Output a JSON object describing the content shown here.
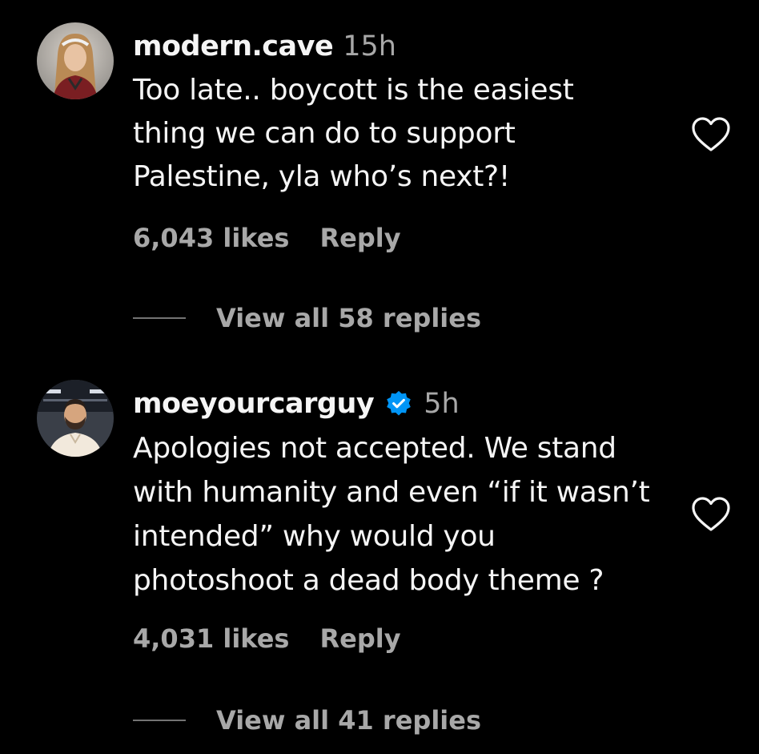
{
  "comments": [
    {
      "username": "modern.cave",
      "time": "15h",
      "verified": false,
      "text_lines": [
        "Too late.. boycott is the easiest",
        "thing we can do to support",
        "Palestine, yla who’s next?!"
      ],
      "likes": "6,043 likes",
      "reply_label": "Reply",
      "view_replies": "View all 58 replies"
    },
    {
      "username": "moeyourcarguy",
      "time": "5h",
      "verified": true,
      "text_lines": [
        "Apologies not accepted. We stand",
        "with humanity and even “if it wasn’t",
        "intended” why would you",
        "photoshoot a dead body theme ?"
      ],
      "likes": "4,031 likes",
      "reply_label": "Reply",
      "view_replies": "View all 41 replies"
    }
  ],
  "colors": {
    "background": "#000000",
    "primary_text": "#f5f5f5",
    "secondary_text": "#a8a8a8",
    "verified_badge": "#0095f6"
  },
  "icons": {
    "like": "heart-outline-icon",
    "verified": "verified-badge-icon"
  }
}
